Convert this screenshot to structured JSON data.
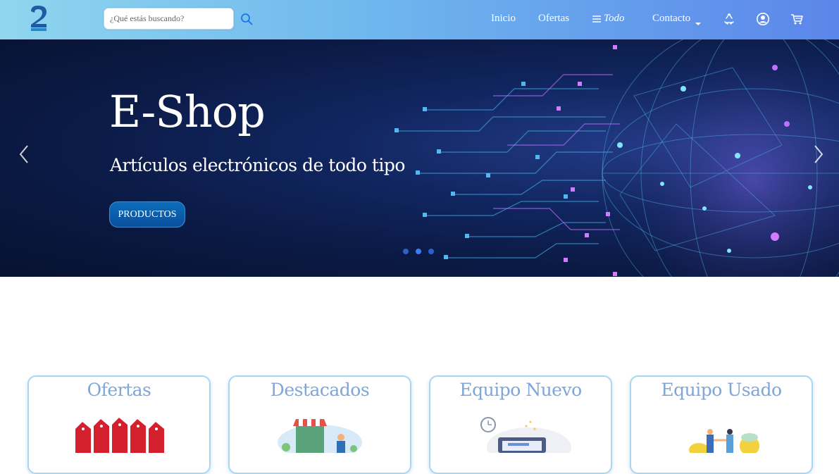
{
  "navbar": {
    "search_placeholder": "¿Qué estás buscando?",
    "links": {
      "home": "Inicio",
      "offers": "Ofertas",
      "all": "Todo",
      "contact": "Contacto"
    },
    "icons": [
      "logo-icon",
      "search-icon",
      "menu-icon",
      "chevron-down-icon",
      "recycle-icon",
      "user-icon",
      "cart-icon"
    ]
  },
  "hero": {
    "title": "E-Shop",
    "subtitle": "Artículos electrónicos de todo tipo",
    "button_label": "PRODUCTOS",
    "slides_total": 3,
    "active_slide": 2
  },
  "categories": [
    {
      "title": "Ofertas"
    },
    {
      "title": "Destacados"
    },
    {
      "title": "Equipo Nuevo"
    },
    {
      "title": "Equipo Usado"
    }
  ],
  "colors": {
    "nav_gradient_start": "#8fd6ee",
    "nav_gradient_end": "#5b86ea",
    "card_title": "#7fa6d8",
    "card_border": "#a9d7f2",
    "hero_button": "#0b4f9c"
  }
}
